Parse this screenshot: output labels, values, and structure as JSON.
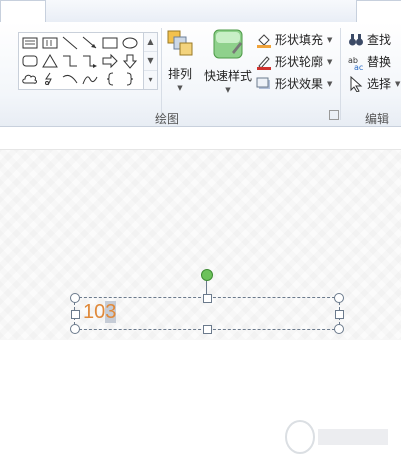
{
  "ribbon": {
    "arrange": {
      "label": "排列"
    },
    "quick_styles": {
      "label": "快速样式"
    },
    "shape_fill": {
      "label": "形状填充"
    },
    "shape_outline": {
      "label": "形状轮廓"
    },
    "shape_effects": {
      "label": "形状效果"
    },
    "find": {
      "label": "查找"
    },
    "replace": {
      "label": "替换"
    },
    "select": {
      "label": "选择"
    },
    "groups": {
      "drawing": "绘图",
      "editing": "编辑"
    }
  },
  "document": {
    "textbox": {
      "text_before": "10",
      "text_selected": "3"
    }
  },
  "colors": {
    "text_orange": "#e0893a",
    "rotate_handle": "#6cc25a"
  }
}
